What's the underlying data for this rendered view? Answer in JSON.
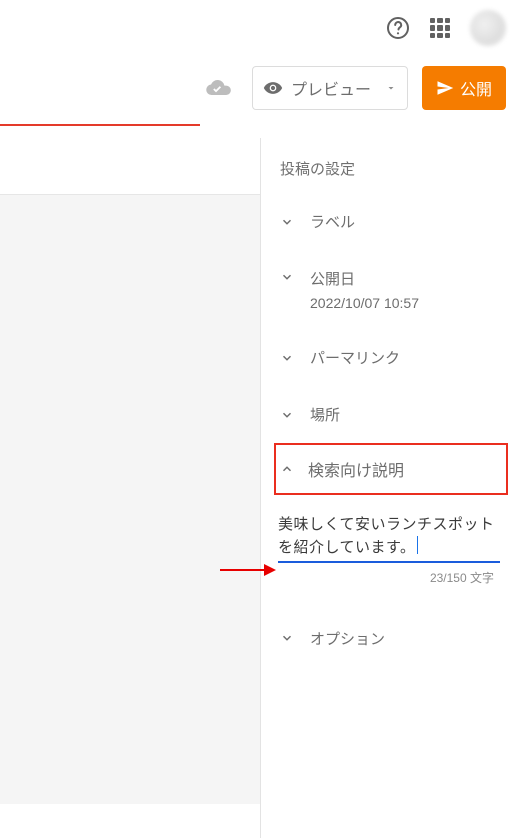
{
  "actions": {
    "preview_label": "プレビュー",
    "publish_label": "公開"
  },
  "settings": {
    "title": "投稿の設定",
    "labels_label": "ラベル",
    "publish_date_label": "公開日",
    "publish_date_value": "2022/10/07 10:57",
    "permalink_label": "パーマリンク",
    "location_label": "場所",
    "search_desc_label": "検索向け説明",
    "search_desc_value": "美味しくて安いランチスポットを紹介しています。",
    "char_count_text": "23/150 文字",
    "options_label": "オプション"
  }
}
